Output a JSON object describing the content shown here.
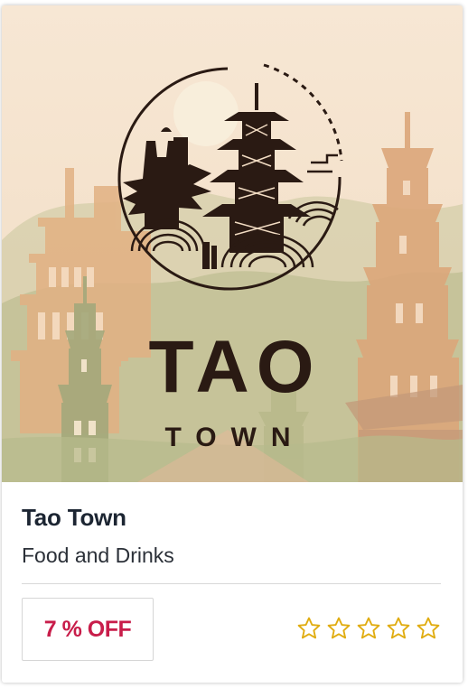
{
  "listing": {
    "logo_word": "TAO",
    "logo_subword": "TOWN",
    "title": "Tao Town",
    "category": "Food and Drinks",
    "discount_label": "7 % OFF",
    "rating": {
      "value": 0,
      "max": 5,
      "icon": "star-outline-icon"
    }
  },
  "colors": {
    "discount_text": "#c81d4a",
    "star_outline": "#e0ac10",
    "title_text": "#1c2532",
    "logo_ink": "#2a1a13",
    "hero_background": "#f6e6d2"
  }
}
